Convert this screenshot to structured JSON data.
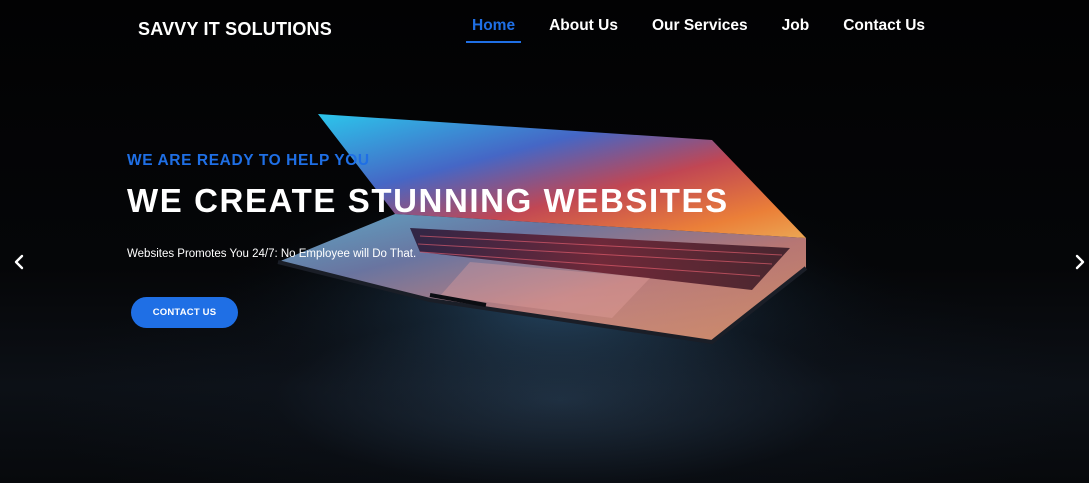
{
  "header": {
    "brand": "SAVVY IT SOLUTIONS",
    "nav": [
      {
        "label": "Home",
        "active": true
      },
      {
        "label": "About Us"
      },
      {
        "label": "Our Services"
      },
      {
        "label": "Job"
      },
      {
        "label": "Contact Us"
      }
    ]
  },
  "hero": {
    "subtitle": "WE ARE READY TO HELP YOU",
    "title": "WE CREATE STUNNING WEBSITES",
    "description": "Websites Promotes You 24/7: No Employee will Do That.",
    "cta_label": "CONTACT US"
  },
  "carousel": {
    "prev_icon": "chevron-left-icon",
    "next_icon": "chevron-right-icon"
  },
  "colors": {
    "accent": "#1f6fe5",
    "background": "#000000",
    "text": "#ffffff"
  }
}
